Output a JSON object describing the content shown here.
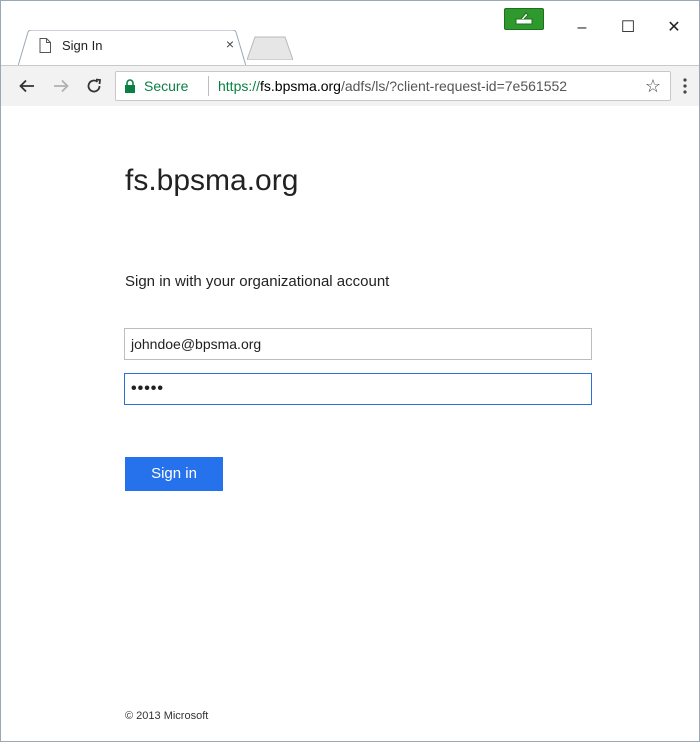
{
  "browser": {
    "tab": {
      "title": "Sign In",
      "close_glyph": "×",
      "icon": "page-icon"
    },
    "window_controls": {
      "minimize": "–",
      "maximize": "☐",
      "close": "✕"
    },
    "address": {
      "secure_label": "Secure",
      "url_scheme": "https://",
      "url_host": "fs.bpsma.org",
      "url_path": "/adfs/ls/?client-request-id=7e561552"
    },
    "icons": [
      "back-arrow-icon",
      "forward-arrow-icon",
      "reload-icon",
      "lock-icon",
      "star-icon",
      "menu-dots-icon",
      "extension-icon"
    ]
  },
  "page": {
    "domain_title": "fs.bpsma.org",
    "subtitle": "Sign in with your organizational account",
    "email_value": "johndoe@bpsma.org",
    "password_mask": "•••••",
    "sign_in_label": "Sign in",
    "footer": "© 2013 Microsoft"
  },
  "colors": {
    "accent": "#2672ec",
    "secure_green": "#0b8043",
    "focus_border": "#2f6ed8"
  }
}
